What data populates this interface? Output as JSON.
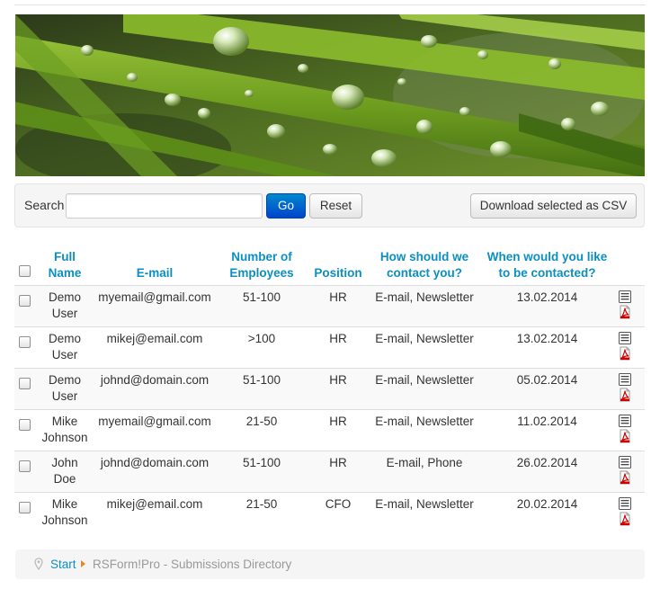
{
  "search": {
    "label": "Search",
    "value": "",
    "placeholder": "",
    "go_label": "Go",
    "reset_label": "Reset",
    "csv_label": "Download selected as CSV"
  },
  "table": {
    "headers": {
      "full_name": "Full Name",
      "email": "E-mail",
      "employees": "Number of Employees",
      "position": "Position",
      "contact": "How should we contact you?",
      "when": "When would you like to be contacted?"
    },
    "rows": [
      {
        "name": "Demo User",
        "email": "myemail@gmail.com",
        "employees": "51-100",
        "position": "HR",
        "contact": "E-mail, Newsletter",
        "date": "13.02.2014"
      },
      {
        "name": "Demo User",
        "email": "mikej@email.com",
        "employees": ">100",
        "position": "HR",
        "contact": "E-mail, Newsletter",
        "date": "13.02.2014"
      },
      {
        "name": "Demo User",
        "email": "johnd@domain.com",
        "employees": "51-100",
        "position": "HR",
        "contact": "E-mail, Newsletter",
        "date": "05.02.2014"
      },
      {
        "name": "Mike Johnson",
        "email": "myemail@gmail.com",
        "employees": "21-50",
        "position": "HR",
        "contact": "E-mail, Newsletter",
        "date": "11.02.2014"
      },
      {
        "name": "John Doe",
        "email": "johnd@domain.com",
        "employees": "51-100",
        "position": "HR",
        "contact": "E-mail, Phone",
        "date": "26.02.2014"
      },
      {
        "name": "Mike Johnson",
        "email": "mikej@email.com",
        "employees": "21-50",
        "position": "CFO",
        "contact": "E-mail, Newsletter",
        "date": "20.02.2014"
      }
    ]
  },
  "breadcrumb": {
    "start": "Start",
    "current": "RSForm!Pro - Submissions Directory"
  },
  "icons": {
    "row_details": "list-details-icon",
    "row_pdf": "pdf-icon",
    "breadcrumb": "map-pin-icon"
  },
  "colors": {
    "header_text": "#0b8fc2",
    "go_button": "#0066cc",
    "breadcrumb_arrow": "#e0892c",
    "pdf_red": "#cc0000"
  }
}
